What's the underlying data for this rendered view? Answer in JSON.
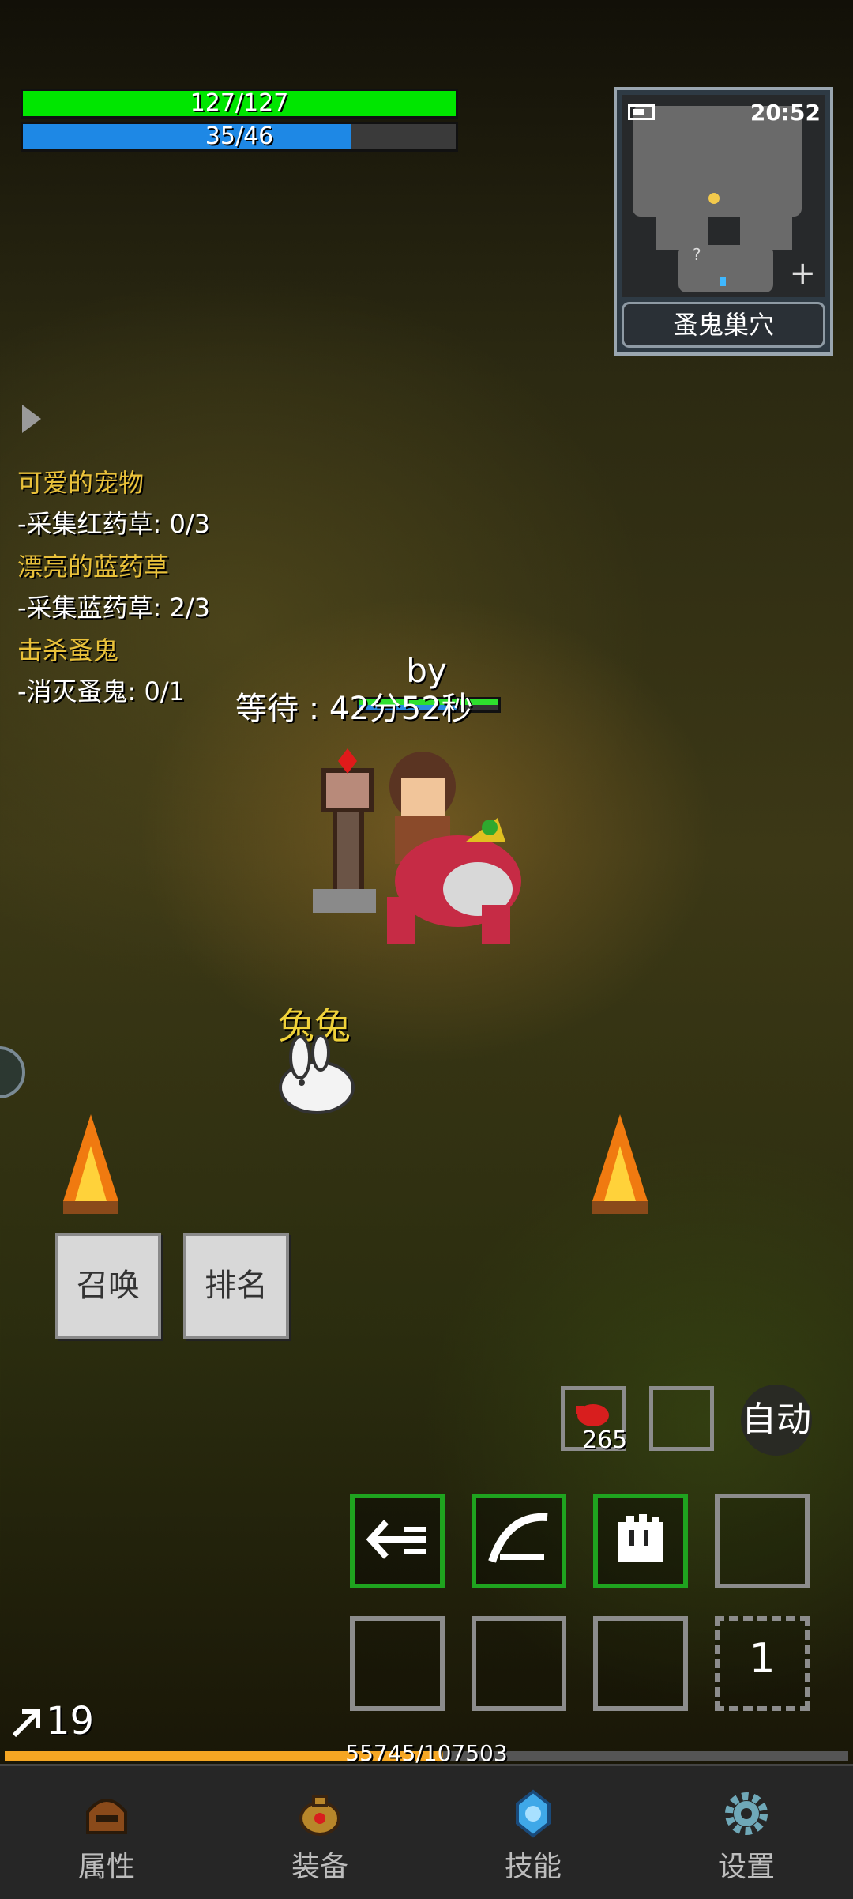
{
  "player": {
    "hp_text": "127/127",
    "hp_fraction": 1.0,
    "mp_text": "35/46",
    "mp_fraction": 0.76,
    "level": "19"
  },
  "minimap": {
    "time": "20:52",
    "location": "蚤鬼巢穴",
    "unknown_marker": "?"
  },
  "quests": [
    {
      "title": "可爱的宠物",
      "task": "-采集红药草: 0/3"
    },
    {
      "title": "漂亮的蓝药草",
      "task": "-采集蓝药草: 2/3"
    },
    {
      "title": "击杀蚤鬼",
      "task": "-消灭蚤鬼: 0/1"
    }
  ],
  "character": {
    "name": "by",
    "wait_text": "等待 : 42分52秒"
  },
  "pet": {
    "name": "兔兔"
  },
  "buttons": {
    "summon": "召唤",
    "ranking": "排名",
    "auto": "自动"
  },
  "items": {
    "potion_count": "265",
    "page_number": "1"
  },
  "experience": {
    "text": "55745/107503",
    "fraction": 0.52
  },
  "nav": [
    {
      "label": "属性",
      "icon": "helmet-icon"
    },
    {
      "label": "装备",
      "icon": "bag-icon"
    },
    {
      "label": "技能",
      "icon": "skill-gem-icon"
    },
    {
      "label": "设置",
      "icon": "gear-icon"
    }
  ],
  "colors": {
    "hp": "#00e600",
    "mp": "#1e88e5",
    "exp": "#f5a623",
    "quest_title": "#e9c13a"
  }
}
